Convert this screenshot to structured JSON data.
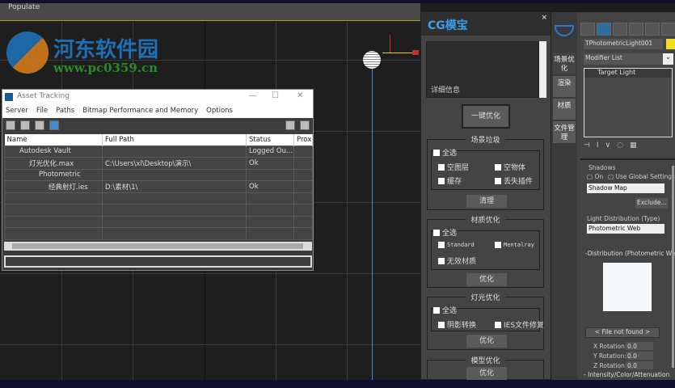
{
  "ribbon": {
    "populate": "Populate"
  },
  "watermark": {
    "title": "河东软件园",
    "url": "www.pc0359.cn"
  },
  "asset": {
    "title": "Asset Tracking",
    "menu": [
      "Server",
      "File",
      "Paths",
      "Bitmap Performance and Memory",
      "Options"
    ],
    "columns": [
      "Name",
      "Full Path",
      "Status",
      "Prox"
    ],
    "rows": [
      {
        "name": "Autodesk Vault",
        "path": "",
        "status": "Logged Ou..."
      },
      {
        "name": "灯光优化.max",
        "path": "C:\\Users\\xl\\Desktop\\演示\\",
        "status": "Ok"
      },
      {
        "name": "Photometric",
        "path": "",
        "status": ""
      },
      {
        "name": "经典射灯.ies",
        "path": "D:\\素材\\1\\",
        "status": "Ok"
      }
    ]
  },
  "cg": {
    "title": "CG模宝",
    "close": "×",
    "details": "详细信息",
    "one_click": "一键优化",
    "scene": {
      "legend": "场景垃圾",
      "all": "全选",
      "opts": [
        "空图层",
        "空物体",
        "缓存",
        "丢失插件"
      ],
      "btn": "清理"
    },
    "material": {
      "legend": "材质优化",
      "all": "全选",
      "opts": [
        "Standard",
        "Mentalray",
        "无效材质"
      ],
      "btn": "优化"
    },
    "light": {
      "legend": "灯光优化",
      "all": "全选",
      "opts": [
        "阴影转换",
        "IES文件修复"
      ],
      "btn": "优化"
    },
    "model": {
      "legend": "模型优化",
      "btn": "优化"
    }
  },
  "sidetabs": [
    "场景优化",
    "渲染",
    "材质",
    "文件管理"
  ],
  "cmd": {
    "object_name": "TPhotometricLight001",
    "object_color": "#f0e020",
    "modifier_list": "Modifier List",
    "stack_item": "Target Light",
    "shadows": "Shadows",
    "on": "On",
    "global": "Use Global Settings",
    "shadow_type": "Shadow Map",
    "exclude": "Exclude...",
    "dist_type_label": "Light Distribution (Type)",
    "dist_type": "Photometric Web",
    "dist_rollout": "-Distribution (Photometric Web)",
    "file_not_found": "< File not found >",
    "xrot": "X Rotation:",
    "yrot": "Y Rotation:",
    "zrot": "Z Rotation:",
    "rot_value": "0.0",
    "intensity": "- Intensity/Color/Attenuation",
    "color": "Color"
  }
}
